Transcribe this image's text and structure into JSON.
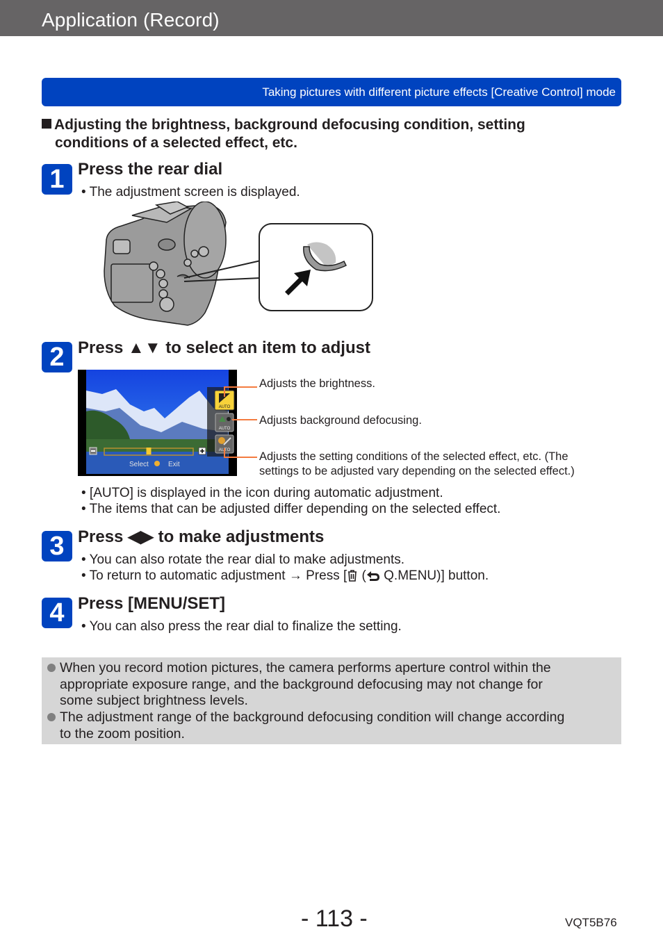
{
  "header": {
    "title": "Application (Record)"
  },
  "section_banner": {
    "text": "Taking pictures with different picture effects  [Creative Control] mode"
  },
  "subheading": {
    "line1": "Adjusting the brightness, background defocusing condition, setting",
    "line2": "conditions of a selected effect, etc."
  },
  "steps": [
    {
      "number": "1",
      "title": "Press the rear dial",
      "bullets": [
        "• The adjustment screen is displayed."
      ]
    },
    {
      "number": "2",
      "title": "Press ▲▼ to select an item to adjust",
      "callouts": [
        "Adjusts the brightness.",
        "Adjusts background defocusing.",
        "Adjusts the setting conditions of the selected effect, etc. (The",
        "settings to be adjusted vary depending on the selected effect.)"
      ],
      "bullets": [
        "• [AUTO] is displayed in the icon during automatic adjustment.",
        "• The items that can be adjusted differ depending on the selected effect."
      ],
      "screen": {
        "icon_labels": [
          "AUTO",
          "AUTO",
          "AUTO"
        ],
        "select_label": "Select",
        "exit_label": "Exit",
        "minus_label": "−",
        "plus_label": "+",
        "slider_value": 0.5
      }
    },
    {
      "number": "3",
      "title": "Press ◀▶ to make adjustments",
      "bullets": [
        "• You can also rotate the rear dial to make adjustments.",
        "• To return to automatic adjustment → Press [",
        " (",
        " Q.MENU)] button."
      ]
    },
    {
      "number": "4",
      "title": "Press [MENU/SET]",
      "bullets": [
        "• You can also press the rear dial to finalize the setting."
      ]
    }
  ],
  "notes": [
    {
      "line1": "When you record motion pictures, the camera performs aperture control within the",
      "line2": "appropriate exposure range, and the background defocusing may not change for",
      "line3": "some subject brightness levels."
    },
    {
      "line1": "The adjustment range of the background defocusing condition will change according",
      "line2": "to the zoom position."
    }
  ],
  "footer": {
    "page_number": "- 113 -",
    "doc_code": "VQT5B76"
  },
  "colors": {
    "brand_blue": "#0043bf",
    "header_gray": "#666465",
    "callout_orange": "#f47b3f",
    "note_bg": "#d6d6d6"
  }
}
